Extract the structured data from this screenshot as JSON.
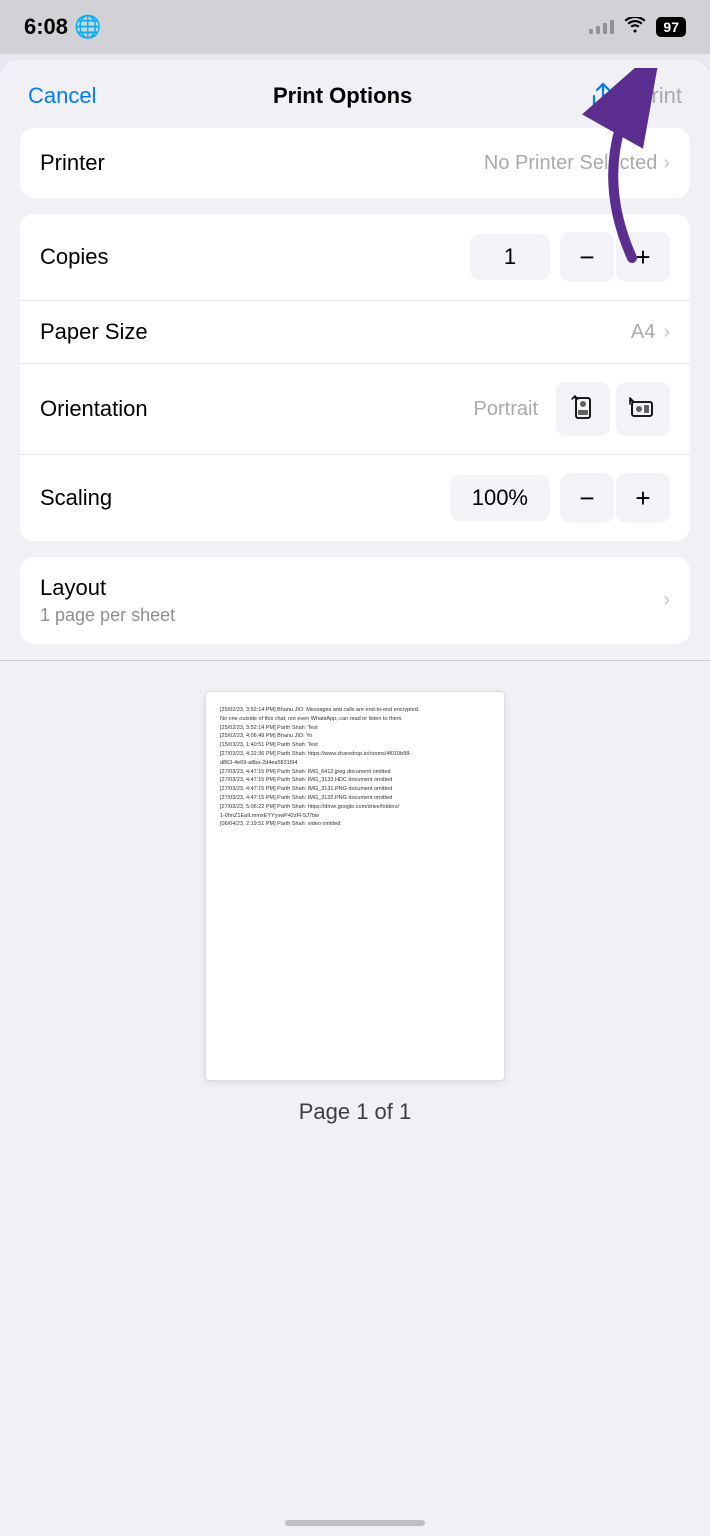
{
  "statusBar": {
    "time": "6:08",
    "globeIcon": "🌐",
    "batteryLevel": "97"
  },
  "header": {
    "cancelLabel": "Cancel",
    "title": "Print Options",
    "printLabel": "Print"
  },
  "printerRow": {
    "label": "Printer",
    "value": "No Printer Selected",
    "chevron": "›"
  },
  "copiesRow": {
    "label": "Copies",
    "value": "1"
  },
  "paperSizeRow": {
    "label": "Paper Size",
    "value": "A4",
    "chevron": "›"
  },
  "orientationRow": {
    "label": "Orientation",
    "portraitLabel": "Portrait"
  },
  "scalingRow": {
    "label": "Scaling",
    "value": "100%"
  },
  "layoutCard": {
    "title": "Layout",
    "subtitle": "1 page per sheet",
    "chevron": "›"
  },
  "preview": {
    "pageIndicator": "Page 1 of 1",
    "lines": [
      "[25/02/23, 3:52:14 PM] Bhanu JIO: Messages and calls are end-to-end encrypted.",
      "No one outside of this chat, not even WhatsApp, can read or listen to them.",
      "[25/02/23, 3:52:14 PM] Parth Shah: Test",
      "[25/02/23, 4:06:49 PM] Bhanu JIO: Yo",
      "[15/03/23, 1:40:51 PM] Parth Shah: Test",
      "[27/03/23, 4:22:36 PM] Parth Shah: https://www.sharedrop.io/rooms/4f010b98-",
      "d863-4e69-a8ba-2d4ea5831f94",
      "[27/03/23, 4:47:15 PM] Parth Shah: IMG_6412.jpeg document omitted",
      "[27/03/23, 4:47:15 PM] Parth Shah: IMG_3133.HDC document omitted",
      "[27/03/23, 4:47:15 PM] Parth Shah: IMG_3131.PNG document omitted",
      "[27/03/23, 4:47:15 PM] Parth Shah: IMG_3132.PNG document omitted",
      "[27/03/23, 5:06:22 PM] Parth Shah: https://drive.google.com/drive/folders/",
      "1-6fmZ1EaILmmxEYYyvwP42zFl-5J7bw",
      "[06/04/23, 2:19:51 PM] Parth Shah: video omitted"
    ]
  }
}
